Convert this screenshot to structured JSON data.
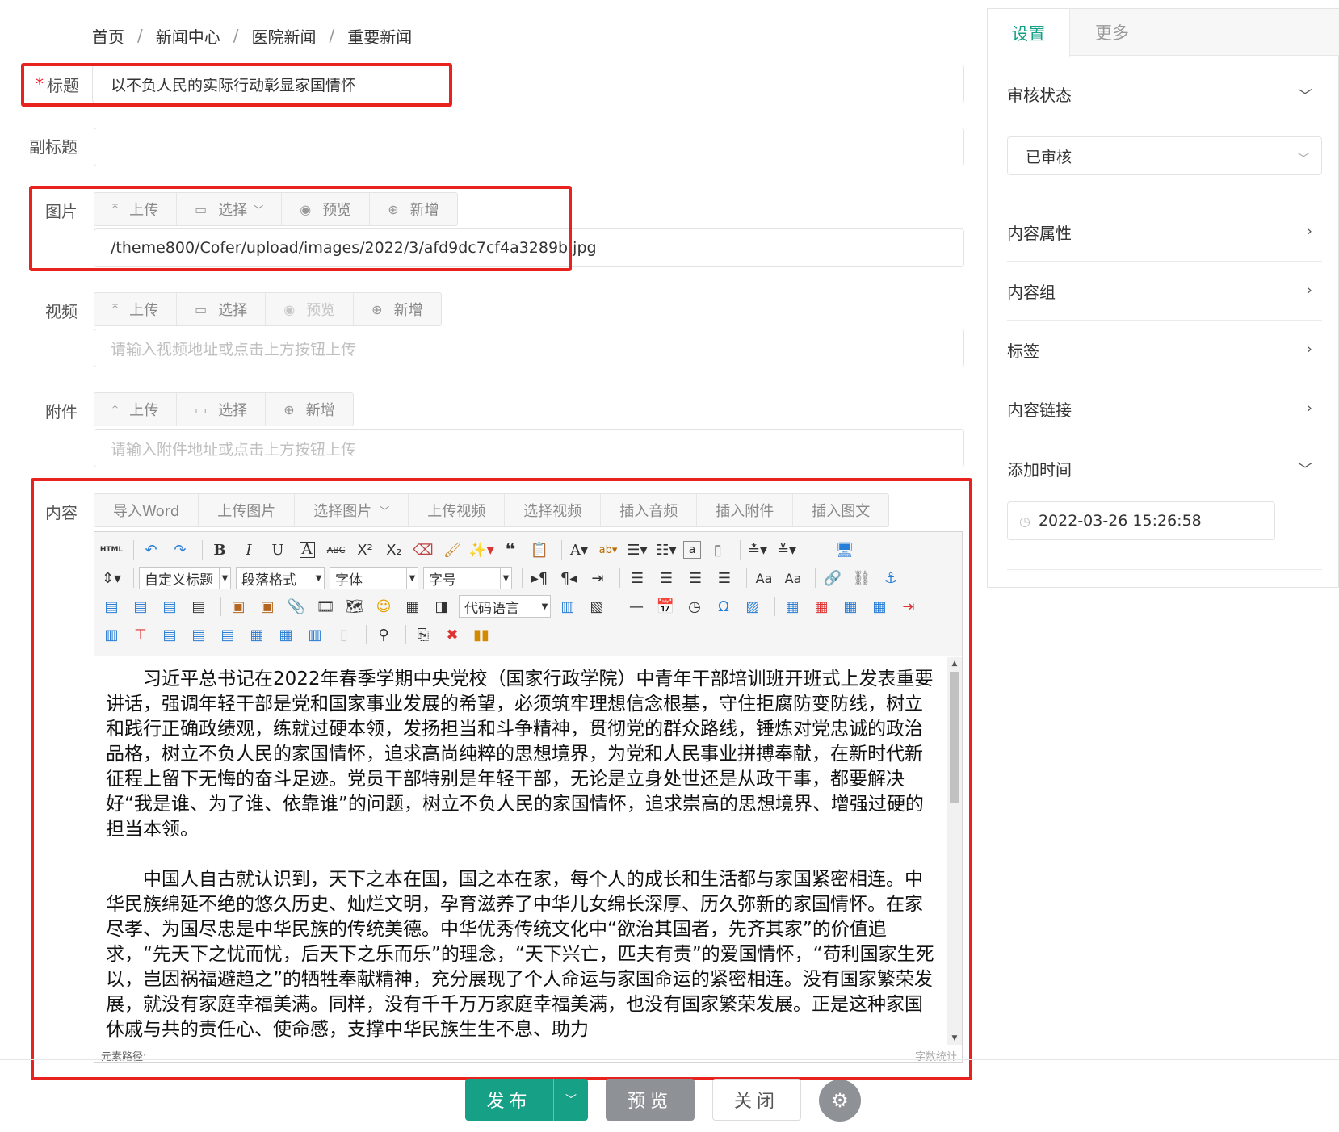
{
  "breadcrumb": [
    "首页",
    "新闻中心",
    "医院新闻",
    "重要新闻"
  ],
  "breadcrumb_sep": "/",
  "form": {
    "title": {
      "label": "标题",
      "required_mark": "*",
      "value": "以不负人民的实际行动彰显家国情怀"
    },
    "subtitle": {
      "label": "副标题",
      "value": ""
    },
    "image": {
      "label": "图片",
      "buttons": [
        {
          "icon": "upload-icon",
          "label": "上传"
        },
        {
          "icon": "folder-icon",
          "label": "选择",
          "dropdown": true
        },
        {
          "icon": "eye-icon",
          "label": "预览"
        },
        {
          "icon": "plus-circle-icon",
          "label": "新增"
        }
      ],
      "value": "/theme800/Cofer/upload/images/2022/3/afd9dc7cf4a3289b.jpg"
    },
    "video": {
      "label": "视频",
      "buttons": [
        {
          "icon": "upload-icon",
          "label": "上传"
        },
        {
          "icon": "folder-icon",
          "label": "选择"
        },
        {
          "icon": "eye-icon",
          "label": "预览",
          "disabled": true
        },
        {
          "icon": "plus-circle-icon",
          "label": "新增"
        }
      ],
      "placeholder": "请输入视频地址或点击上方按钮上传"
    },
    "attachment": {
      "label": "附件",
      "buttons": [
        {
          "icon": "upload-icon",
          "label": "上传"
        },
        {
          "icon": "folder-icon",
          "label": "选择"
        },
        {
          "icon": "plus-circle-icon",
          "label": "新增"
        }
      ],
      "placeholder": "请输入附件地址或点击上方按钮上传"
    },
    "content": {
      "label": "内容",
      "toolbar": [
        "导入Word",
        "上传图片",
        "选择图片",
        "上传视频",
        "选择视频",
        "插入音频",
        "插入附件",
        "插入图文"
      ],
      "editor_selects": {
        "custom_title": "自定义标题",
        "paragraph": "段落格式",
        "font": "字体",
        "size": "字号",
        "code_lang": "代码语言"
      },
      "html_label": "HTML",
      "paragraphs": [
        "习近平总书记在2022年春季学期中央党校（国家行政学院）中青年干部培训班开班式上发表重要讲话，强调年轻干部是党和国家事业发展的希望，必须筑牢理想信念根基，守住拒腐防变防线，树立和践行正确政绩观，练就过硬本领，发扬担当和斗争精神，贯彻党的群众路线，锤炼对党忠诚的政治品格，树立不负人民的家国情怀，追求高尚纯粹的思想境界，为党和人民事业拼搏奉献，在新时代新征程上留下无悔的奋斗足迹。党员干部特别是年轻干部，无论是立身处世还是从政干事，都要解决好“我是谁、为了谁、依靠谁”的问题，树立不负人民的家国情怀，追求崇高的思想境界、增强过硬的担当本领。",
        "中国人自古就认识到，天下之本在国，国之本在家，每个人的成长和生活都与家国紧密相连。中华民族绵延不绝的悠久历史、灿烂文明，孕育滋养了中华儿女绵长深厚、历久弥新的家国情怀。在家尽孝、为国尽忠是中华民族的传统美德。中华优秀传统文化中“欲治其国者，先齐其家”的价值追求，“先天下之忧而忧，后天下之乐而乐”的理念，“天下兴亡，匹夫有责”的爱国情怀，“苟利国家生死以，岂因祸福避趋之”的牺牲奉献精神，充分展现了个人命运与家国命运的紧密相连。没有国家繁荣发展，就没有家庭幸福美满。同样，没有千千万万家庭幸福美满，也没有国家繁荣发展。正是这种家国休戚与共的责任心、使命感，支撑中华民族生生不息、助力"
      ],
      "status_left": "元素路径:",
      "status_right": "字数统计"
    }
  },
  "actions": {
    "publish": "发布",
    "preview": "预览",
    "close": "关闭"
  },
  "panel": {
    "tabs": [
      "设置",
      "更多"
    ],
    "sections": [
      {
        "label": "审核状态",
        "expanded": true,
        "value": "已审核"
      },
      {
        "label": "内容属性"
      },
      {
        "label": "内容组"
      },
      {
        "label": "标签"
      },
      {
        "label": "内容链接"
      },
      {
        "label": "添加时间",
        "expanded": true,
        "value": "2022-03-26 15:26:58"
      }
    ]
  },
  "colors": {
    "accent": "#16a085",
    "highlight_box": "#e8231f",
    "gray_button": "#8e9196"
  }
}
